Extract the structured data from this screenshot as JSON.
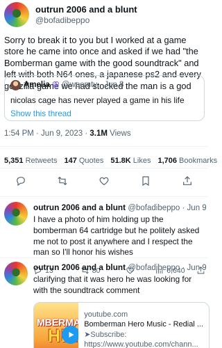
{
  "main_tweet": {
    "display_name": "outrun 2006 and a blunt",
    "handle": "@bofadibeppo",
    "text": "Sorry to break it to you but I worked at a game store he came into once and asked if we had \"the Bomberman game with the good soundtrack\" and left with both N64 ones, a japanese ps2 and every godzilla game we had stocked the man is a god",
    "quote": {
      "name": "Amelia",
      "badge": "⚢",
      "handle": "@woomty",
      "date": "Jun 8",
      "text": "nicolas cage has never played a game in his life",
      "show_thread": "Show this thread"
    },
    "time": "1:54 PM · Jun 9, 2023 · ",
    "views_count": "3.1M",
    "views_label": " Views",
    "stats": {
      "retweets": "5,351",
      "retweets_label": "Retweets",
      "quotes": "147",
      "quotes_label": "Quotes",
      "likes": "51.8K",
      "likes_label": "Likes",
      "bookmarks": "1,706",
      "bookmarks_label": "Bookmarks"
    }
  },
  "replies": [
    {
      "display_name": "outrun 2006 and a blunt",
      "handle_date": "@bofadibeppo · Jun 9",
      "text": "I have a photo of him holding up the bomberman 64 cartridge but he politely asked me not to post it anywhere and I respect the man so I'll honor his wishes",
      "reply_count": "13",
      "retweet_count": "80",
      "view_count": "6,640"
    },
    {
      "display_name": "outrun 2006 and a blunt",
      "handle_date": "@bofadibeppo · Jun 9",
      "text": "clarifying that it was hero he was looking for with the soundtrack comment",
      "card": {
        "thumb_line1": "MBERMAN",
        "thumb_line2": "HERO",
        "domain": "youtube.com",
        "title": "Bomberman Hero Music - Redial ...",
        "desc1": "➤Subscribe:",
        "desc2": "https://www.youtube.com/chann..."
      }
    }
  ],
  "colors": {
    "link": "#1d9bf0",
    "muted": "#536471",
    "text": "#0f1419",
    "border": "#cfd9de"
  }
}
